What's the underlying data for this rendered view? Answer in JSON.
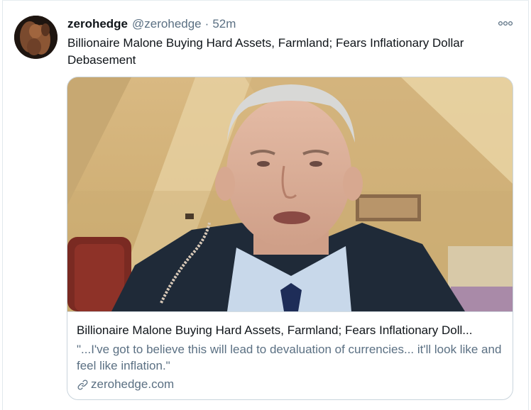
{
  "tweet": {
    "author": {
      "display_name": "zerohedge",
      "handle": "@zerohedge",
      "avatar_icon": "profile-photo"
    },
    "separator": "·",
    "timestamp": "52m",
    "more_icon": "more-options-icon",
    "text": "Billionaire Malone Buying Hard Assets, Farmland; Fears Inflationary Dollar Debasement"
  },
  "card": {
    "image": "video-still-man-in-vest",
    "title": "Billionaire Malone Buying Hard Assets, Farmland; Fears Inflationary Doll...",
    "description": "\"...I've got to believe this will lead to devaluation of currencies... it'll look like and feel like inflation.\"",
    "link_icon": "link-icon",
    "domain": "zerohedge.com"
  },
  "colors": {
    "text_primary": "#0f1419",
    "text_secondary": "#5b7083",
    "card_border": "#c9d4dc"
  }
}
